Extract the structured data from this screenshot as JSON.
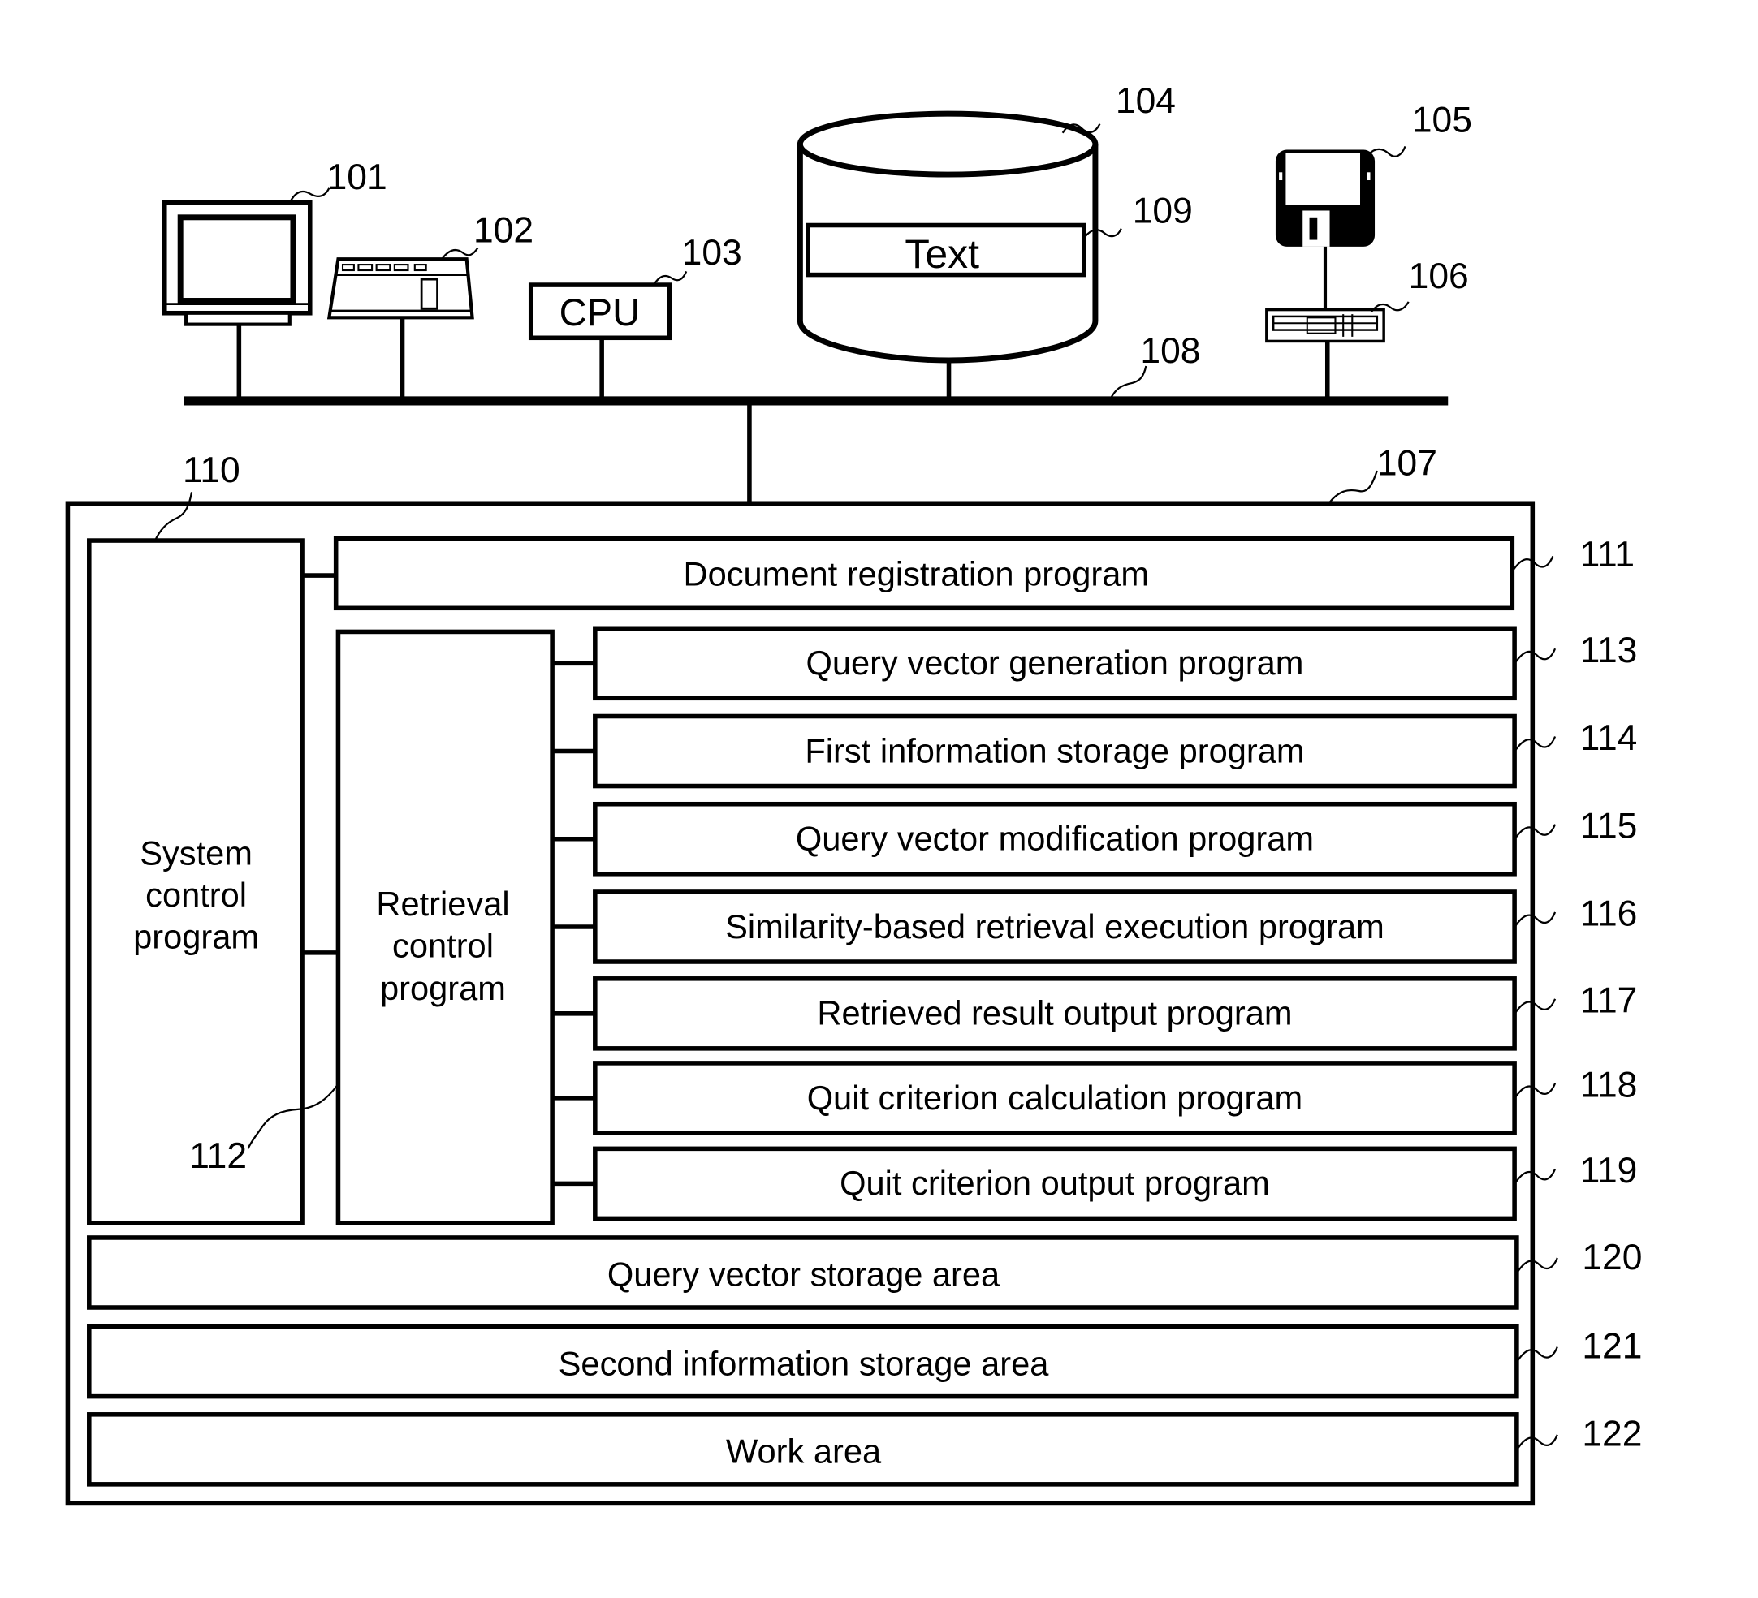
{
  "figure": {
    "devices": {
      "display": {
        "ref": "101"
      },
      "keyboard": {
        "ref": "102"
      },
      "cpu": {
        "label": "CPU",
        "ref": "103"
      },
      "storage": {
        "ref": "104",
        "text_box": {
          "label": "Text",
          "ref": "109"
        }
      },
      "floppy_disk": {
        "ref": "105"
      },
      "floppy_drive": {
        "ref": "106"
      },
      "bus": {
        "ref": "108"
      }
    },
    "memory": {
      "ref": "107",
      "system_control": {
        "label_lines": [
          "System",
          "control",
          "program"
        ],
        "ref": "110"
      },
      "retrieval_control": {
        "label_lines": [
          "Retrieval",
          "control",
          "program"
        ],
        "ref": "112"
      },
      "document_registration": {
        "label": "Document registration program",
        "ref": "111"
      },
      "programs": [
        {
          "label": "Query vector generation program",
          "ref": "113"
        },
        {
          "label": "First information storage program",
          "ref": "114"
        },
        {
          "label": "Query vector modification program",
          "ref": "115"
        },
        {
          "label": "Similarity-based retrieval execution program",
          "ref": "116"
        },
        {
          "label": "Retrieved result output program",
          "ref": "117"
        },
        {
          "label": "Quit criterion calculation program",
          "ref": "118"
        },
        {
          "label": "Quit criterion output program",
          "ref": "119"
        }
      ],
      "areas": [
        {
          "label": "Query vector storage area",
          "ref": "120"
        },
        {
          "label": "Second information storage area",
          "ref": "121"
        },
        {
          "label": "Work area",
          "ref": "122"
        }
      ]
    }
  }
}
